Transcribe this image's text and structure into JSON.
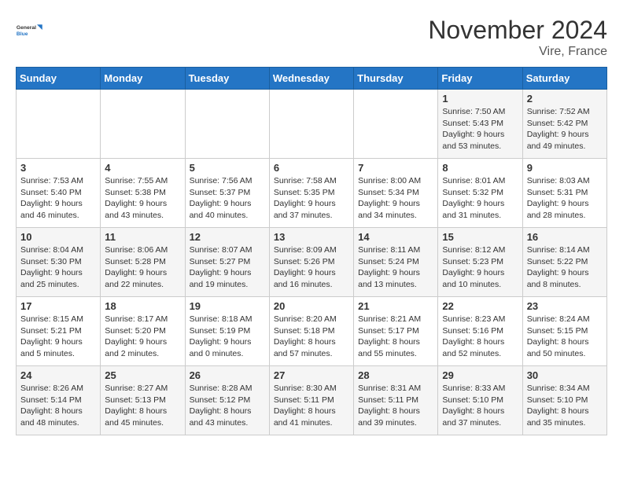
{
  "logo": {
    "line1": "General",
    "line2": "Blue"
  },
  "title": "November 2024",
  "location": "Vire, France",
  "days_of_week": [
    "Sunday",
    "Monday",
    "Tuesday",
    "Wednesday",
    "Thursday",
    "Friday",
    "Saturday"
  ],
  "weeks": [
    [
      {
        "day": "",
        "info": ""
      },
      {
        "day": "",
        "info": ""
      },
      {
        "day": "",
        "info": ""
      },
      {
        "day": "",
        "info": ""
      },
      {
        "day": "",
        "info": ""
      },
      {
        "day": "1",
        "info": "Sunrise: 7:50 AM\nSunset: 5:43 PM\nDaylight: 9 hours and 53 minutes."
      },
      {
        "day": "2",
        "info": "Sunrise: 7:52 AM\nSunset: 5:42 PM\nDaylight: 9 hours and 49 minutes."
      }
    ],
    [
      {
        "day": "3",
        "info": "Sunrise: 7:53 AM\nSunset: 5:40 PM\nDaylight: 9 hours and 46 minutes."
      },
      {
        "day": "4",
        "info": "Sunrise: 7:55 AM\nSunset: 5:38 PM\nDaylight: 9 hours and 43 minutes."
      },
      {
        "day": "5",
        "info": "Sunrise: 7:56 AM\nSunset: 5:37 PM\nDaylight: 9 hours and 40 minutes."
      },
      {
        "day": "6",
        "info": "Sunrise: 7:58 AM\nSunset: 5:35 PM\nDaylight: 9 hours and 37 minutes."
      },
      {
        "day": "7",
        "info": "Sunrise: 8:00 AM\nSunset: 5:34 PM\nDaylight: 9 hours and 34 minutes."
      },
      {
        "day": "8",
        "info": "Sunrise: 8:01 AM\nSunset: 5:32 PM\nDaylight: 9 hours and 31 minutes."
      },
      {
        "day": "9",
        "info": "Sunrise: 8:03 AM\nSunset: 5:31 PM\nDaylight: 9 hours and 28 minutes."
      }
    ],
    [
      {
        "day": "10",
        "info": "Sunrise: 8:04 AM\nSunset: 5:30 PM\nDaylight: 9 hours and 25 minutes."
      },
      {
        "day": "11",
        "info": "Sunrise: 8:06 AM\nSunset: 5:28 PM\nDaylight: 9 hours and 22 minutes."
      },
      {
        "day": "12",
        "info": "Sunrise: 8:07 AM\nSunset: 5:27 PM\nDaylight: 9 hours and 19 minutes."
      },
      {
        "day": "13",
        "info": "Sunrise: 8:09 AM\nSunset: 5:26 PM\nDaylight: 9 hours and 16 minutes."
      },
      {
        "day": "14",
        "info": "Sunrise: 8:11 AM\nSunset: 5:24 PM\nDaylight: 9 hours and 13 minutes."
      },
      {
        "day": "15",
        "info": "Sunrise: 8:12 AM\nSunset: 5:23 PM\nDaylight: 9 hours and 10 minutes."
      },
      {
        "day": "16",
        "info": "Sunrise: 8:14 AM\nSunset: 5:22 PM\nDaylight: 9 hours and 8 minutes."
      }
    ],
    [
      {
        "day": "17",
        "info": "Sunrise: 8:15 AM\nSunset: 5:21 PM\nDaylight: 9 hours and 5 minutes."
      },
      {
        "day": "18",
        "info": "Sunrise: 8:17 AM\nSunset: 5:20 PM\nDaylight: 9 hours and 2 minutes."
      },
      {
        "day": "19",
        "info": "Sunrise: 8:18 AM\nSunset: 5:19 PM\nDaylight: 9 hours and 0 minutes."
      },
      {
        "day": "20",
        "info": "Sunrise: 8:20 AM\nSunset: 5:18 PM\nDaylight: 8 hours and 57 minutes."
      },
      {
        "day": "21",
        "info": "Sunrise: 8:21 AM\nSunset: 5:17 PM\nDaylight: 8 hours and 55 minutes."
      },
      {
        "day": "22",
        "info": "Sunrise: 8:23 AM\nSunset: 5:16 PM\nDaylight: 8 hours and 52 minutes."
      },
      {
        "day": "23",
        "info": "Sunrise: 8:24 AM\nSunset: 5:15 PM\nDaylight: 8 hours and 50 minutes."
      }
    ],
    [
      {
        "day": "24",
        "info": "Sunrise: 8:26 AM\nSunset: 5:14 PM\nDaylight: 8 hours and 48 minutes."
      },
      {
        "day": "25",
        "info": "Sunrise: 8:27 AM\nSunset: 5:13 PM\nDaylight: 8 hours and 45 minutes."
      },
      {
        "day": "26",
        "info": "Sunrise: 8:28 AM\nSunset: 5:12 PM\nDaylight: 8 hours and 43 minutes."
      },
      {
        "day": "27",
        "info": "Sunrise: 8:30 AM\nSunset: 5:11 PM\nDaylight: 8 hours and 41 minutes."
      },
      {
        "day": "28",
        "info": "Sunrise: 8:31 AM\nSunset: 5:11 PM\nDaylight: 8 hours and 39 minutes."
      },
      {
        "day": "29",
        "info": "Sunrise: 8:33 AM\nSunset: 5:10 PM\nDaylight: 8 hours and 37 minutes."
      },
      {
        "day": "30",
        "info": "Sunrise: 8:34 AM\nSunset: 5:10 PM\nDaylight: 8 hours and 35 minutes."
      }
    ]
  ]
}
